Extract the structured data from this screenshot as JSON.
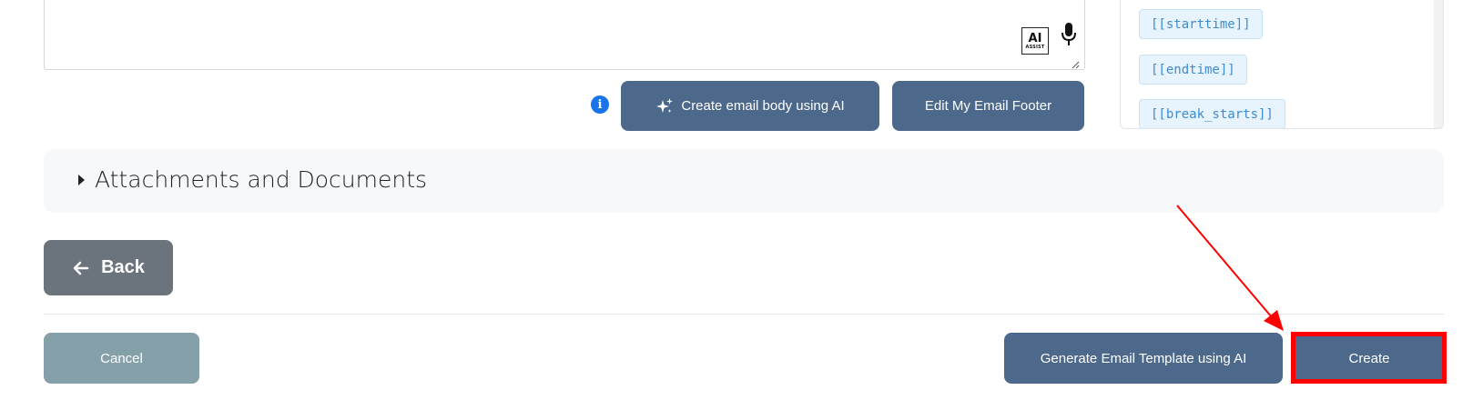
{
  "editor": {
    "ai_assist_big": "AI",
    "ai_assist_small": "ASSIST"
  },
  "actions": {
    "create_body_ai_label": "Create email body using AI",
    "edit_footer_label": "Edit My Email Footer"
  },
  "variables": {
    "items": [
      "[[starttime]]",
      "[[endtime]]",
      "[[break_starts]]"
    ]
  },
  "attachments": {
    "title": "Attachments and Documents"
  },
  "navigation": {
    "back_label": "Back"
  },
  "footer": {
    "cancel_label": "Cancel",
    "generate_label": "Generate Email Template using AI",
    "create_label": "Create"
  },
  "colors": {
    "primary": "#4c698c",
    "cancel": "#85a0a8",
    "back": "#6b737d",
    "annotation": "#ff0000",
    "chip_text": "#3d8bd1",
    "info": "#1a73e8"
  }
}
